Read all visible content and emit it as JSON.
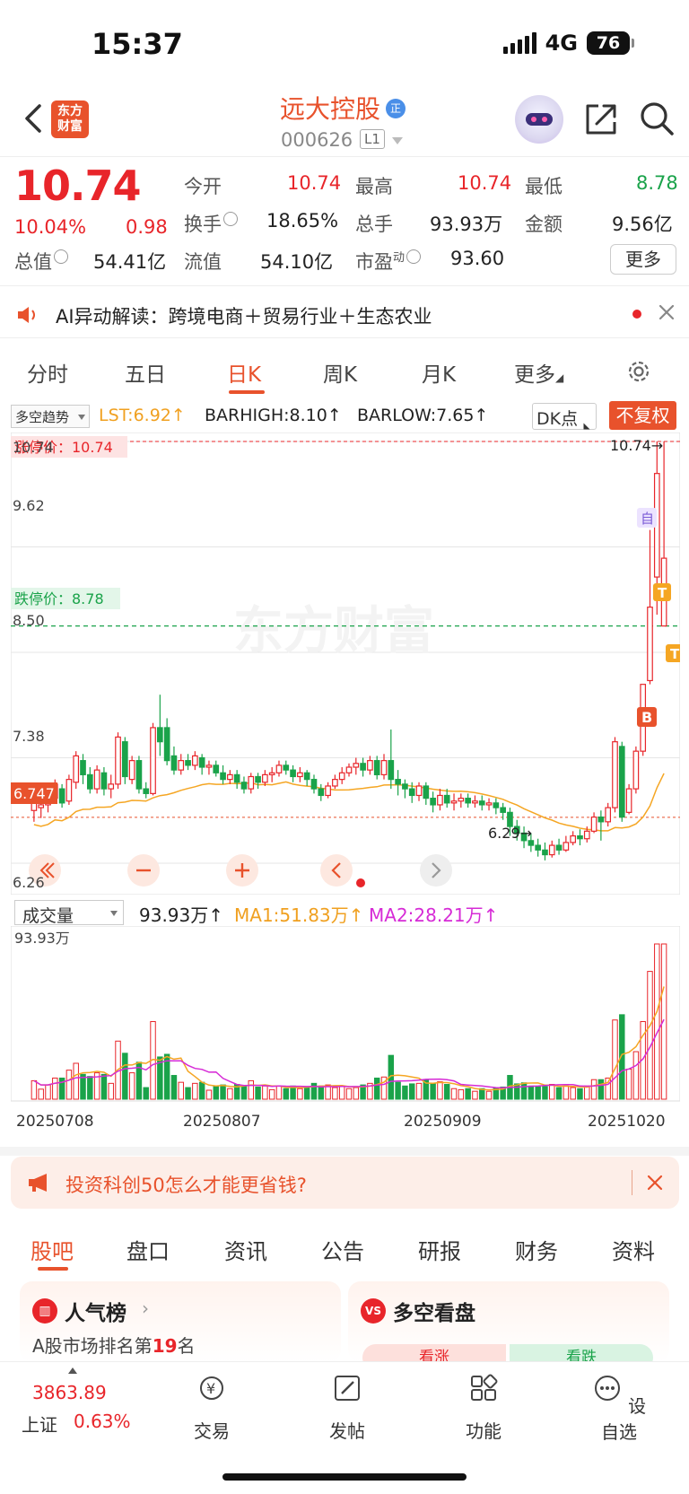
{
  "status_bar": {
    "time": "15:37",
    "network": "4G",
    "battery": "76"
  },
  "header": {
    "logo_line1": "东方",
    "logo_line2": "财富",
    "stock_name": "远大控股",
    "badge": "正",
    "stock_code": "000626",
    "level": "L1"
  },
  "quote": {
    "price": "10.74",
    "change_pct": "10.04%",
    "change": "0.98",
    "open_label": "今开",
    "open": "10.74",
    "high_label": "最高",
    "high": "10.74",
    "low_label": "最低",
    "low": "8.78",
    "turnover_label": "换手",
    "turnover": "18.65%",
    "volume_label": "总手",
    "volume": "93.93万",
    "amount_label": "金额",
    "amount": "9.56亿",
    "mktcap_label": "总值",
    "mktcap": "54.41亿",
    "float_label": "流值",
    "float_cap": "54.10亿",
    "pe_label": "市盈",
    "pe_sup": "动",
    "pe": "93.60",
    "more": "更多"
  },
  "ai_banner": {
    "text": "AI异动解读：跨境电商＋贸易行业＋生态农业"
  },
  "period_tabs": [
    "分时",
    "五日",
    "日K",
    "周K",
    "月K",
    "更多"
  ],
  "indicator_bar": {
    "select": "多空趋势",
    "lst": "LST:6.92↑",
    "barhigh": "BARHIGH:8.10↑",
    "barlow": "BARLOW:7.65↑",
    "dk": "DK点",
    "fq": "不复权"
  },
  "kline": {
    "limit_up_label": "涨停价：10.74",
    "limit_down_label": "跌停价：8.78",
    "last_close_tag": "6.747",
    "max_marker": "10.74→",
    "min_marker": "6.29→",
    "axis_labels": [
      "10.74",
      "9.62",
      "8.50",
      "7.38",
      "6.26"
    ],
    "watermark": "东方财富",
    "self_select_tag": "自",
    "markers": {
      "b": "B",
      "t": "T"
    }
  },
  "volume": {
    "select": "成交量",
    "vol": "93.93万↑",
    "ma1": "MA1:51.83万↑",
    "ma2": "MA2:28.21万↑",
    "max_label": "93.93万",
    "dates": [
      "20250708",
      "20250807",
      "20250909",
      "20251020"
    ]
  },
  "promo": {
    "text": "投资科创50怎么才能更省钱?"
  },
  "bottom_tabs": [
    "股吧",
    "盘口",
    "资讯",
    "公告",
    "研报",
    "财务",
    "资料"
  ],
  "cards": {
    "rank_title": "人气榜",
    "rank_sub_pre": "A股市场排名第",
    "rank_num": "19",
    "rank_sub_post": "名",
    "vs_title": "多空看盘",
    "vs_up": "看涨",
    "vs_down": "看跌"
  },
  "nav": {
    "index_value": "3863.89",
    "index_name": "上证",
    "index_change": "0.63%",
    "trade": "交易",
    "post": "发帖",
    "func": "功能",
    "watch": "设自选"
  },
  "colors": {
    "up": "#e8252a",
    "down": "#1aa34a",
    "brand": "#e8522c"
  },
  "chart_data": {
    "type": "candlestick",
    "y_range": [
      6.26,
      10.74
    ],
    "y_ticks": [
      10.74,
      9.62,
      8.5,
      7.38,
      6.26
    ],
    "date_ticks": [
      "20250708",
      "20250807",
      "20250909",
      "20251020"
    ],
    "limit_up": 10.74,
    "limit_down": 8.78,
    "ref_line": 6.747,
    "candles": [
      [
        6.82,
        6.92,
        6.7,
        6.95
      ],
      [
        6.85,
        6.88,
        6.74,
        6.9
      ],
      [
        6.88,
        6.95,
        6.8,
        7.0
      ],
      [
        6.95,
        7.1,
        6.9,
        7.15
      ],
      [
        7.05,
        6.9,
        6.85,
        7.1
      ],
      [
        6.92,
        7.15,
        6.88,
        7.2
      ],
      [
        7.12,
        7.4,
        7.05,
        7.45
      ],
      [
        7.35,
        7.2,
        7.1,
        7.42
      ],
      [
        7.2,
        7.05,
        7.0,
        7.28
      ],
      [
        7.05,
        7.25,
        7.0,
        7.3
      ],
      [
        7.22,
        7.05,
        6.98,
        7.28
      ],
      [
        7.05,
        7.1,
        6.95,
        7.2
      ],
      [
        7.1,
        7.6,
        7.05,
        7.65
      ],
      [
        7.55,
        7.18,
        7.1,
        7.6
      ],
      [
        7.15,
        7.35,
        7.1,
        7.4
      ],
      [
        7.35,
        7.05,
        7.0,
        7.4
      ],
      [
        7.05,
        7.0,
        6.95,
        7.12
      ],
      [
        7.0,
        7.7,
        6.98,
        7.75
      ],
      [
        7.7,
        7.55,
        7.4,
        8.05
      ],
      [
        7.7,
        7.35,
        7.3,
        7.8
      ],
      [
        7.4,
        7.25,
        7.2,
        7.5
      ],
      [
        7.25,
        7.35,
        7.2,
        7.42
      ],
      [
        7.35,
        7.3,
        7.25,
        7.42
      ],
      [
        7.3,
        7.4,
        7.25,
        7.45
      ],
      [
        7.38,
        7.28,
        7.2,
        7.42
      ],
      [
        7.28,
        7.3,
        7.2,
        7.35
      ],
      [
        7.3,
        7.22,
        7.18,
        7.35
      ],
      [
        7.22,
        7.15,
        7.1,
        7.3
      ],
      [
        7.15,
        7.2,
        7.1,
        7.25
      ],
      [
        7.2,
        7.12,
        7.05,
        7.25
      ],
      [
        7.12,
        7.05,
        7.0,
        7.18
      ],
      [
        7.05,
        7.18,
        7.0,
        7.22
      ],
      [
        7.18,
        7.12,
        7.05,
        7.22
      ],
      [
        7.12,
        7.2,
        7.08,
        7.25
      ],
      [
        7.2,
        7.22,
        7.12,
        7.28
      ],
      [
        7.22,
        7.3,
        7.18,
        7.35
      ],
      [
        7.3,
        7.25,
        7.2,
        7.35
      ],
      [
        7.25,
        7.18,
        7.12,
        7.3
      ],
      [
        7.18,
        7.22,
        7.12,
        7.28
      ],
      [
        7.22,
        7.15,
        7.08,
        7.25
      ],
      [
        7.15,
        7.05,
        7.0,
        7.2
      ],
      [
        7.05,
        6.98,
        6.92,
        7.1
      ],
      [
        6.98,
        7.08,
        6.95,
        7.12
      ],
      [
        7.08,
        7.15,
        7.05,
        7.2
      ],
      [
        7.15,
        7.22,
        7.1,
        7.28
      ],
      [
        7.22,
        7.28,
        7.18,
        7.32
      ],
      [
        7.28,
        7.32,
        7.2,
        7.38
      ],
      [
        7.32,
        7.25,
        7.18,
        7.38
      ],
      [
        7.25,
        7.35,
        7.2,
        7.4
      ],
      [
        7.35,
        7.2,
        7.15,
        7.4
      ],
      [
        7.2,
        7.35,
        7.15,
        7.42
      ],
      [
        7.35,
        7.15,
        7.05,
        7.68
      ],
      [
        7.15,
        7.1,
        6.98,
        7.25
      ],
      [
        7.1,
        7.05,
        6.95,
        7.15
      ],
      [
        7.05,
        6.98,
        6.9,
        7.12
      ],
      [
        6.98,
        7.08,
        6.92,
        7.12
      ],
      [
        7.08,
        6.95,
        6.88,
        7.12
      ],
      [
        6.95,
        6.88,
        6.8,
        7.02
      ],
      [
        6.88,
        6.98,
        6.82,
        7.05
      ],
      [
        6.98,
        6.9,
        6.85,
        7.05
      ],
      [
        6.9,
        6.92,
        6.82,
        7.0
      ],
      [
        6.92,
        6.95,
        6.85,
        7.0
      ],
      [
        6.95,
        6.9,
        6.85,
        7.0
      ],
      [
        6.9,
        6.92,
        6.85,
        6.98
      ],
      [
        6.92,
        6.88,
        6.82,
        6.98
      ],
      [
        6.88,
        6.9,
        6.82,
        6.95
      ],
      [
        6.9,
        6.85,
        6.78,
        6.95
      ],
      [
        6.85,
        6.8,
        6.72,
        6.9
      ],
      [
        6.8,
        6.65,
        6.55,
        6.85
      ],
      [
        6.65,
        6.58,
        6.5,
        6.72
      ],
      [
        6.58,
        6.5,
        6.42,
        6.65
      ],
      [
        6.5,
        6.45,
        6.38,
        6.58
      ],
      [
        6.45,
        6.4,
        6.33,
        6.52
      ],
      [
        6.4,
        6.35,
        6.29,
        6.48
      ],
      [
        6.35,
        6.45,
        6.32,
        6.5
      ],
      [
        6.45,
        6.4,
        6.35,
        6.52
      ],
      [
        6.4,
        6.48,
        6.38,
        6.55
      ],
      [
        6.48,
        6.55,
        6.45,
        6.6
      ],
      [
        6.55,
        6.52,
        6.45,
        6.62
      ],
      [
        6.52,
        6.6,
        6.48,
        6.65
      ],
      [
        6.6,
        6.75,
        6.58,
        6.8
      ],
      [
        6.75,
        6.7,
        6.5,
        6.82
      ],
      [
        6.7,
        6.85,
        6.65,
        6.9
      ],
      [
        6.85,
        7.55,
        6.8,
        7.6
      ],
      [
        7.5,
        6.75,
        6.7,
        7.55
      ],
      [
        6.8,
        7.05,
        6.78,
        7.1
      ],
      [
        7.05,
        7.45,
        7.0,
        7.5
      ],
      [
        7.45,
        8.16,
        7.4,
        8.16
      ],
      [
        8.2,
        8.98,
        8.16,
        9.8
      ],
      [
        9.3,
        10.4,
        8.9,
        10.74
      ],
      [
        8.78,
        9.5,
        8.78,
        10.74
      ]
    ]
  }
}
